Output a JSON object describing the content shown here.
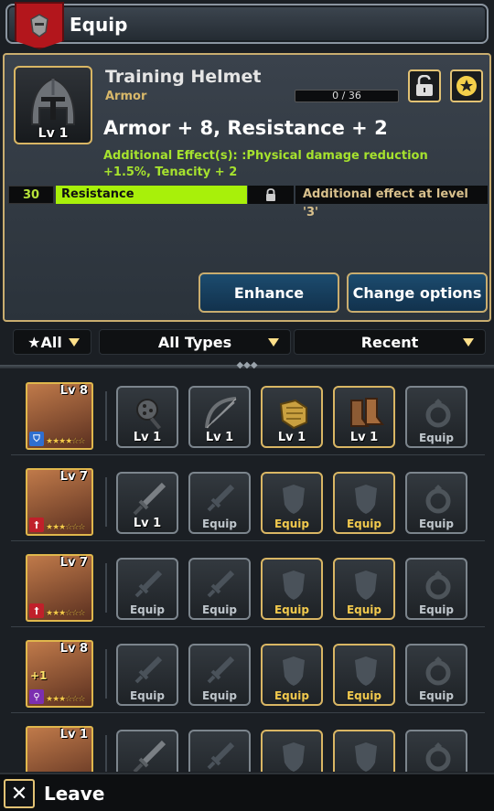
{
  "header": {
    "title": "Equip",
    "badge_icon": "armor-badge-icon"
  },
  "item": {
    "name": "Training Helmet",
    "category": "Armor",
    "level_label": "Lv 1",
    "enhance_progress": "0 / 36",
    "enhance_fraction": 0.0,
    "main_stats": "Armor + 8, Resistance + 2",
    "additional_effects": "Additional Effect(s): :Physical damage reduction +1.5%, Tenacity + 2",
    "option_value": "30",
    "option_name": "Resistance",
    "option_note": "Additional effect at level '3'",
    "enhance_label": "Enhance",
    "change_options_label": "Change options",
    "accent_green": "#a8f00a",
    "gold": "#d9b664"
  },
  "filters": {
    "all_label": "★All",
    "types_label": "All Types",
    "sort_label": "Recent"
  },
  "heroes": [
    {
      "level": "Lv 8",
      "class_icon": "shield-icon",
      "stars": "★★★★☆☆",
      "slots": [
        {
          "label": "Lv 1",
          "icon": "mace-icon"
        },
        {
          "label": "Lv 1",
          "icon": "bow-icon"
        },
        {
          "label": "Lv 1",
          "icon": "gauntlet-icon"
        },
        {
          "label": "Lv 1",
          "icon": "boots-icon"
        },
        {
          "label": "Equip",
          "icon": "ring-icon"
        }
      ]
    },
    {
      "level": "Lv 7",
      "class_icon": "sword-class-icon",
      "stars": "★★★☆☆☆",
      "slots": [
        {
          "label": "Lv 1",
          "icon": "greatsword-icon"
        },
        {
          "label": "Equip",
          "icon": "weapon-icon"
        },
        {
          "label": "Equip",
          "icon": "armor-icon"
        },
        {
          "label": "Equip",
          "icon": "armor-icon"
        },
        {
          "label": "Equip",
          "icon": "ring-icon"
        }
      ]
    },
    {
      "level": "Lv 7",
      "class_icon": "sword-class-icon",
      "stars": "★★★☆☆☆",
      "slots": [
        {
          "label": "Equip",
          "icon": "weapon-icon"
        },
        {
          "label": "Equip",
          "icon": "weapon-icon"
        },
        {
          "label": "Equip",
          "icon": "armor-icon"
        },
        {
          "label": "Equip",
          "icon": "armor-icon"
        },
        {
          "label": "Equip",
          "icon": "ring-icon"
        }
      ]
    },
    {
      "level": "Lv 8",
      "class_icon": "staff-icon",
      "stars": "★★★☆☆☆",
      "plus": "+1",
      "slots": [
        {
          "label": "Equip",
          "icon": "weapon-icon"
        },
        {
          "label": "Equip",
          "icon": "weapon-icon"
        },
        {
          "label": "Equip",
          "icon": "armor-icon"
        },
        {
          "label": "Equip",
          "icon": "armor-icon"
        },
        {
          "label": "Equip",
          "icon": "ring-icon"
        }
      ]
    },
    {
      "level": "Lv 1",
      "class_icon": "",
      "stars": "",
      "slots": [
        {
          "label": "",
          "icon": "greatsword-icon"
        },
        {
          "label": "",
          "icon": "weapon-icon"
        },
        {
          "label": "",
          "icon": "armor-icon"
        },
        {
          "label": "",
          "icon": "armor-icon"
        },
        {
          "label": "",
          "icon": "ring-icon"
        }
      ]
    }
  ],
  "footer": {
    "leave_label": "Leave",
    "close_glyph": "✕"
  }
}
